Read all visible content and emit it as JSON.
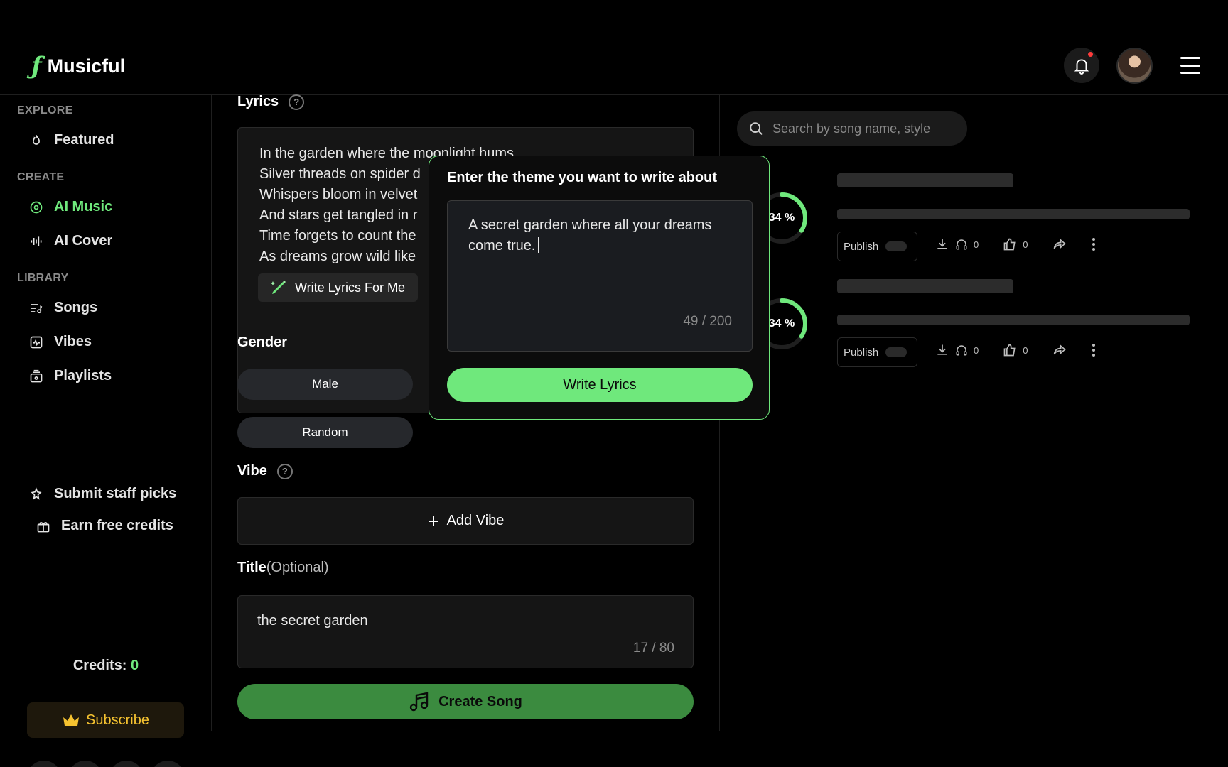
{
  "header": {
    "logo_mark": "ƒ",
    "app_name": "Musicful"
  },
  "sidebar": {
    "sections": {
      "explore": "EXPLORE",
      "create": "CREATE",
      "library": "LIBRARY"
    },
    "items": [
      {
        "label": "Featured",
        "icon": "flame-icon"
      },
      {
        "label": "AI Music",
        "icon": "music-disc-icon",
        "active": true
      },
      {
        "label": "AI Cover",
        "icon": "waveform-icon"
      },
      {
        "label": "Songs",
        "icon": "song-list-icon"
      },
      {
        "label": "Vibes",
        "icon": "vibes-icon"
      },
      {
        "label": "Playlists",
        "icon": "playlist-icon"
      }
    ],
    "submit_staff_picks": "Submit staff picks",
    "earn_free_credits": "Earn free credits",
    "credits_label": "Credits:",
    "credits_value": "0",
    "subscribe_label": "Subscribe",
    "socials": [
      "youtube-icon",
      "tiktok-icon",
      "discord-icon",
      "x-icon"
    ]
  },
  "form": {
    "lyrics_label": "Lyrics",
    "lyrics_text": "In the garden where the moonlight hums,\nSilver threads on spider d\nWhispers bloom in velvet\nAnd stars get tangled in r\nTime forgets to count the\nAs dreams grow wild like",
    "write_for_me_label": "Write Lyrics For Me",
    "gender_label": "Gender",
    "gender_options": [
      "Male",
      "Random"
    ],
    "vibe_label": "Vibe",
    "add_vibe_label": "Add Vibe",
    "title_label": "Title",
    "title_optional": "(Optional)",
    "title_value": "the secret garden",
    "title_count": "17 / 80",
    "create_song_label": "Create Song"
  },
  "modal": {
    "title": "Enter the theme you want to write about",
    "theme_value": "A secret garden where all your dreams come true.",
    "char_count": "49 / 200",
    "submit_label": "Write Lyrics"
  },
  "right_panel": {
    "search_placeholder": "Search by song name, style",
    "songs": [
      {
        "progress": 34,
        "progress_label": "34 %",
        "publish_label": "Publish",
        "listens": "0",
        "likes": "0"
      },
      {
        "progress": 34,
        "progress_label": "34 %",
        "publish_label": "Publish",
        "listens": "0",
        "likes": "0"
      }
    ]
  },
  "colors": {
    "accent": "#6fe87c",
    "create_button": "#3b8b3f",
    "subscribe_text": "#f5c230",
    "notification_dot": "#ff3b3b"
  }
}
